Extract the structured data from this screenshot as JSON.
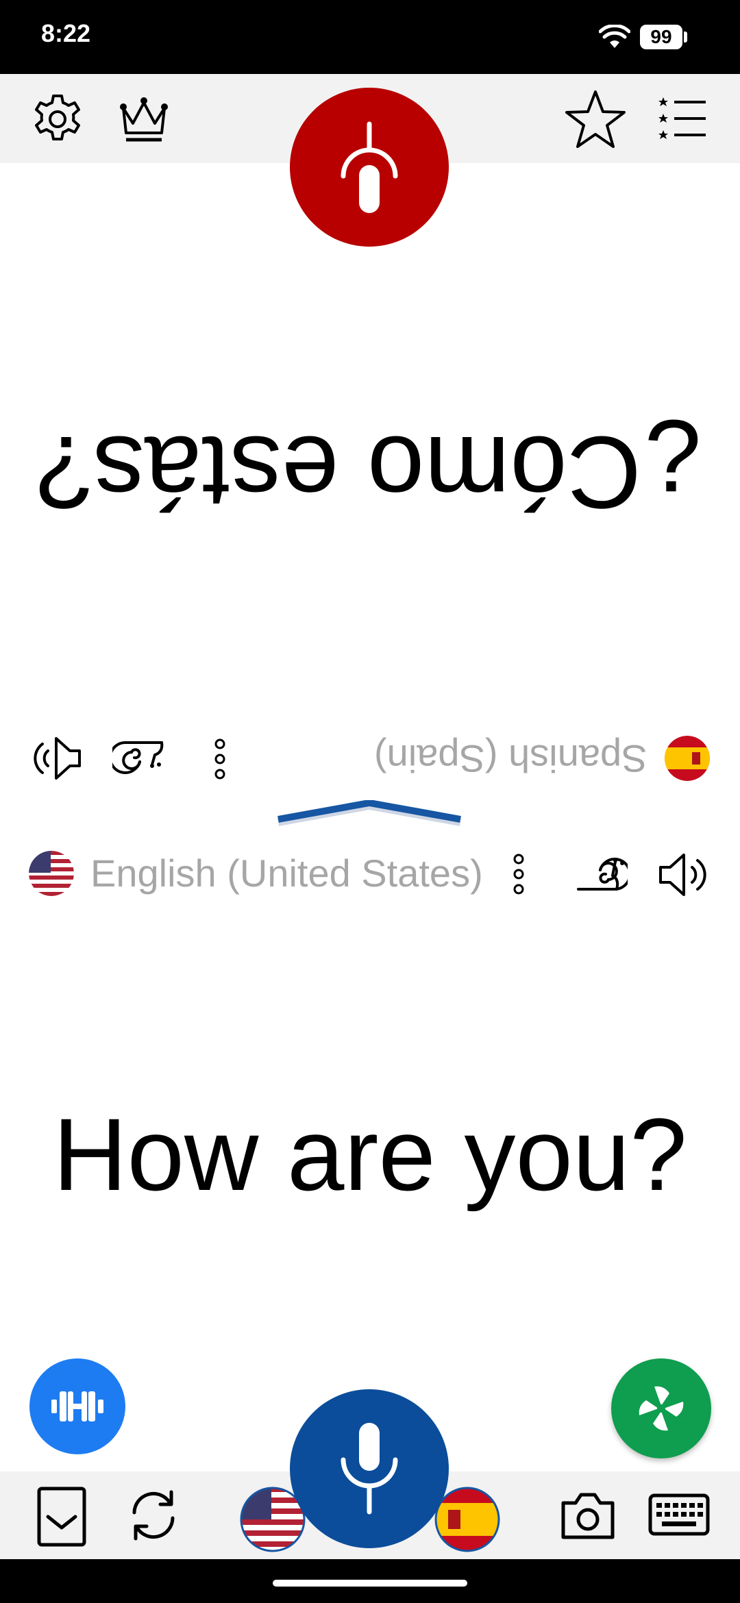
{
  "status_bar": {
    "time": "8:22",
    "battery": "99"
  },
  "top_bar": {
    "icons": [
      "gear-icon",
      "crown-icon",
      "star-icon",
      "starred-list-icon"
    ],
    "mic_button": "microphone-icon"
  },
  "spanish_panel": {
    "phrase": "¿Cómo estás?",
    "language": "Spanish (Spain)",
    "icons": [
      "speaker-icon",
      "snail-icon",
      "more-vertical-icon",
      "spain-flag-icon"
    ]
  },
  "english_panel": {
    "phrase": "How are you?",
    "language": "English (United States)",
    "icons": [
      "us-flag-icon",
      "more-vertical-icon",
      "snail-icon",
      "speaker-icon"
    ]
  },
  "bottom_bar": {
    "icons": [
      "collapse-icon",
      "swap-icon",
      "us-flag-icon",
      "microphone-icon",
      "spain-flag-icon",
      "camera-icon",
      "keyboard-icon"
    ]
  },
  "fabs": {
    "left": "dumbbell-icon",
    "right": "pinwheel-icon"
  },
  "colors": {
    "red_mic": "#b80000",
    "blue_mic": "#0b4d9a",
    "fab_blue": "#1e7cf2",
    "fab_green": "#0f9d4f",
    "divider_blue": "#1656a3",
    "label_gray": "#a6a6a6"
  }
}
